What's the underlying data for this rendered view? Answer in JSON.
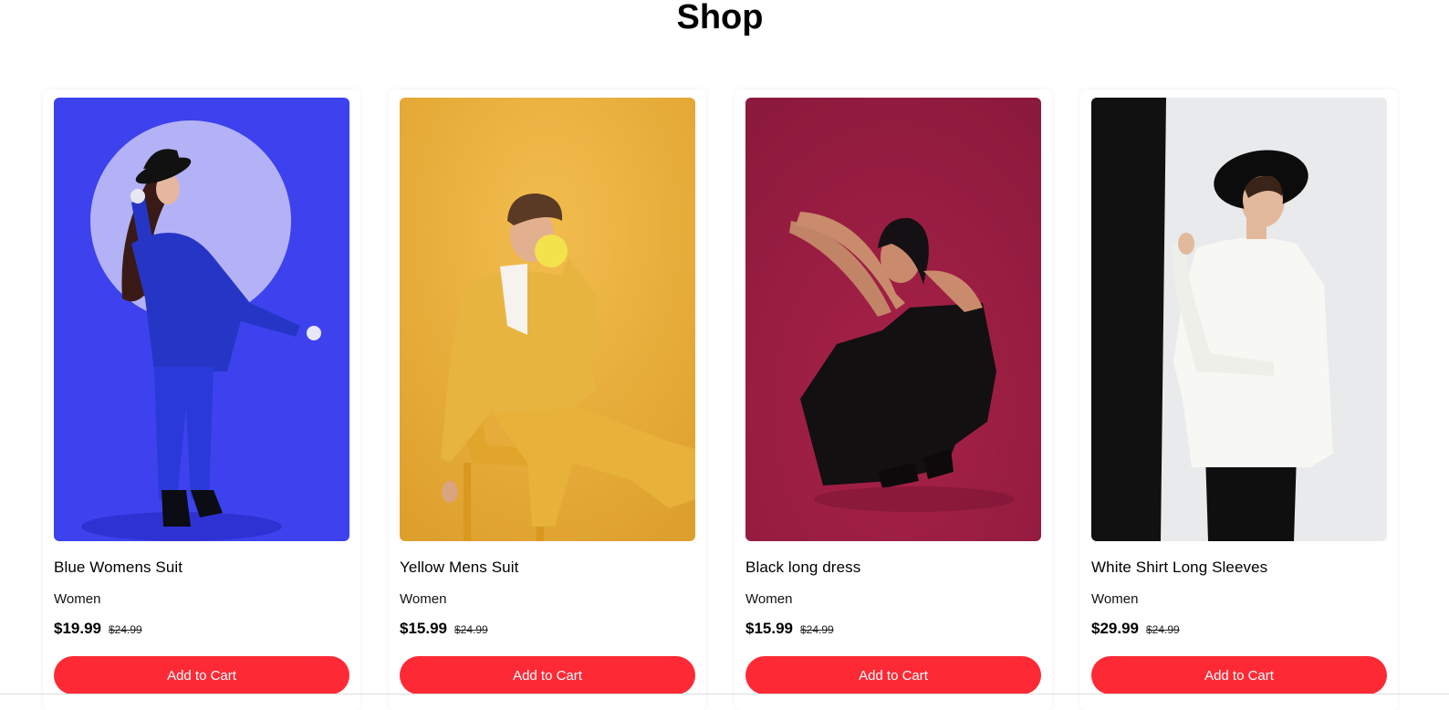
{
  "page": {
    "title": "Shop"
  },
  "colors": {
    "button": "#fd2a36",
    "card_bg": "#ffffff"
  },
  "products": [
    {
      "name": "Blue Womens Suit",
      "category": "Women",
      "price": "$19.99",
      "old_price": "$24.99",
      "button_label": "Add to Cart",
      "photo_bg": "#3d42ee"
    },
    {
      "name": "Yellow Mens Suit",
      "category": "Women",
      "price": "$15.99",
      "old_price": "$24.99",
      "button_label": "Add to Cart",
      "photo_bg": "#e7ae3a"
    },
    {
      "name": "Black long dress",
      "category": "Women",
      "price": "$15.99",
      "old_price": "$24.99",
      "button_label": "Add to Cart",
      "photo_bg": "#941a3f"
    },
    {
      "name": "White Shirt Long Sleeves",
      "category": "Women",
      "price": "$29.99",
      "old_price": "$24.99",
      "button_label": "Add to Cart",
      "photo_bg": "#e8eaec"
    }
  ]
}
